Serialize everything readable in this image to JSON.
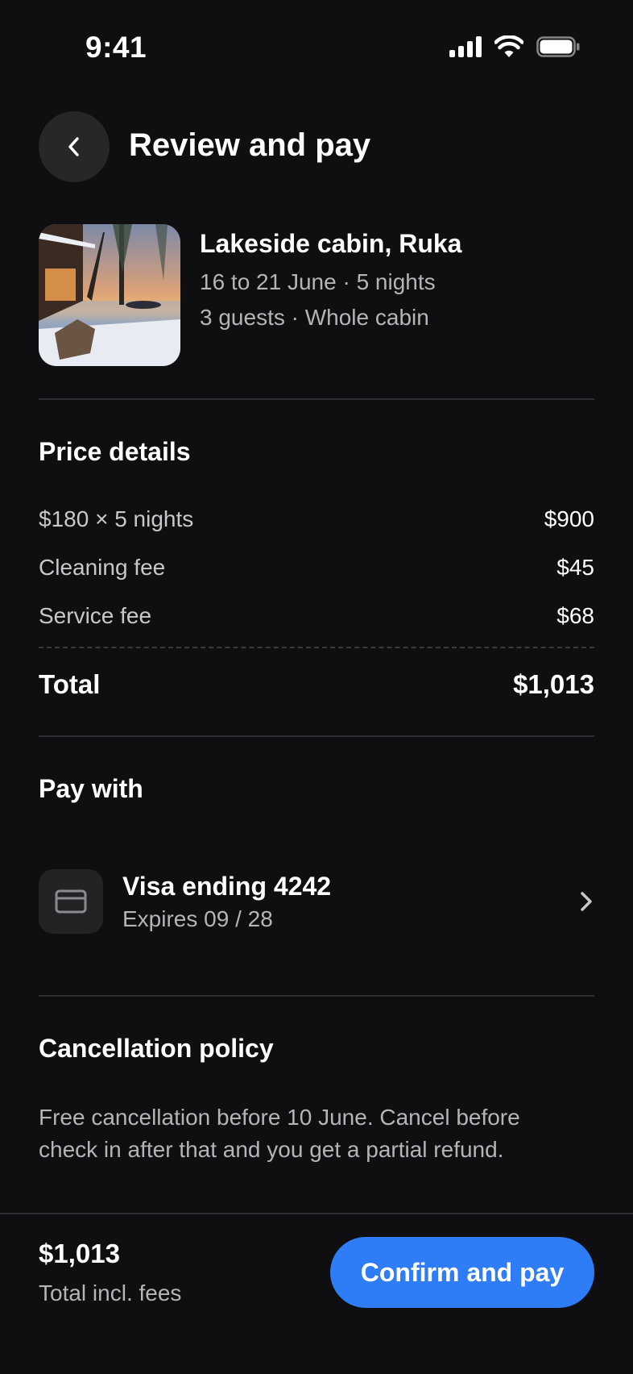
{
  "status_bar": {
    "time": "9:41"
  },
  "header": {
    "title": "Review and pay",
    "back_icon": "chevron-left-icon"
  },
  "listing": {
    "name": "Lakeside cabin, Ruka",
    "dates": "16 to 21 June · 5 nights",
    "guests": "3 guests · Whole cabin"
  },
  "price_details": {
    "title": "Price details",
    "rows": [
      {
        "label": "$180 × 5 nights",
        "amount": "$900"
      },
      {
        "label": "Cleaning fee",
        "amount": "$45"
      },
      {
        "label": "Service fee",
        "amount": "$68"
      }
    ],
    "total_label": "Total",
    "total_amount": "$1,013"
  },
  "payment": {
    "title": "Pay with",
    "card_name": "Visa ending 4242",
    "card_expiry": "Expires 09 / 28",
    "card_icon": "credit-card-icon"
  },
  "cancellation": {
    "title": "Cancellation policy",
    "text": "Free cancellation before 10 June. Cancel before check in after that and you get a partial refund."
  },
  "bottom_bar": {
    "price": "$1,013",
    "subtitle": "Total incl. fees",
    "confirm_label": "Confirm and pay"
  },
  "colors": {
    "accent": "#2e7cf6",
    "background": "#0f0f11",
    "muted_text": "#b4b4b9"
  }
}
